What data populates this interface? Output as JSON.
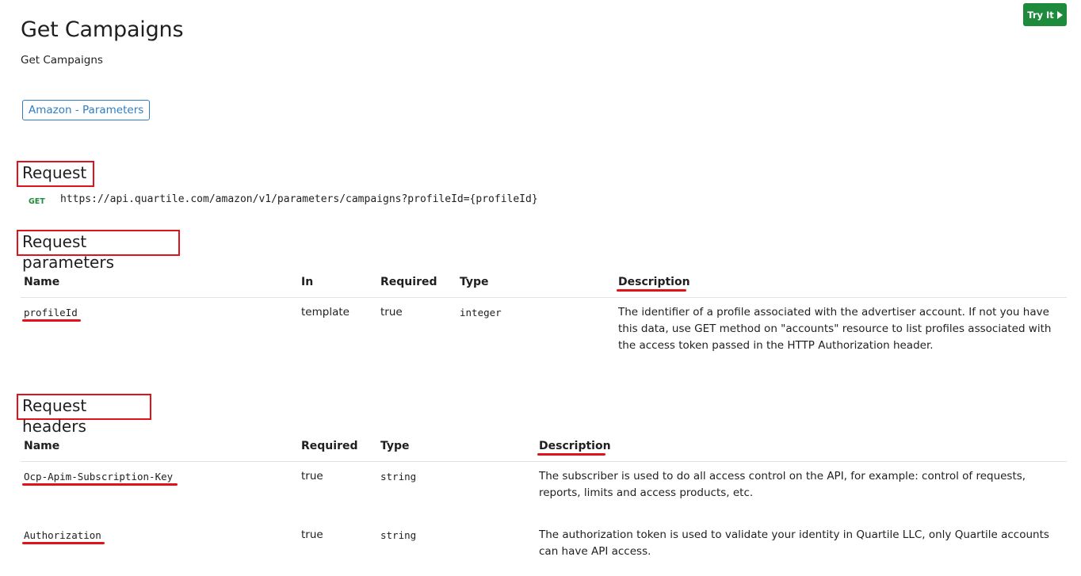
{
  "header": {
    "title": "Get Campaigns",
    "subtitle": "Get Campaigns",
    "tag": "Amazon - Parameters",
    "try_it": "Try It",
    "try_icon": "play-icon"
  },
  "request": {
    "heading": "Request",
    "method": "GET",
    "url": "https://api.quartile.com/amazon/v1/parameters/campaigns?profileId={profileId}"
  },
  "params": {
    "heading": "Request parameters",
    "columns": [
      "Name",
      "In",
      "Required",
      "Type",
      "Description"
    ],
    "rows": [
      {
        "name": "profileId",
        "in": "template",
        "required": "true",
        "type": "integer",
        "description": "The identifier of a profile associated with the advertiser account. If not you have this data, use GET method on \"accounts\" resource to list profiles associated with the access token passed in the HTTP Authorization header."
      }
    ]
  },
  "headers": {
    "heading": "Request headers",
    "columns": [
      "Name",
      "Required",
      "Type",
      "Description"
    ],
    "rows": [
      {
        "name": "Ocp-Apim-Subscription-Key",
        "required": "true",
        "type": "string",
        "description": "The subscriber is used to do all access control on the API, for example: control of requests, reports, limits and access products, etc."
      },
      {
        "name": "Authorization",
        "required": "true",
        "type": "string",
        "description": "The authorization token is used to validate your identity in Quartile LLC, only Quartile accounts can have API access."
      }
    ]
  },
  "annotation_color": "#e0131b",
  "accent_color": "#2f7dc4",
  "try_color": "#1e8a3b"
}
